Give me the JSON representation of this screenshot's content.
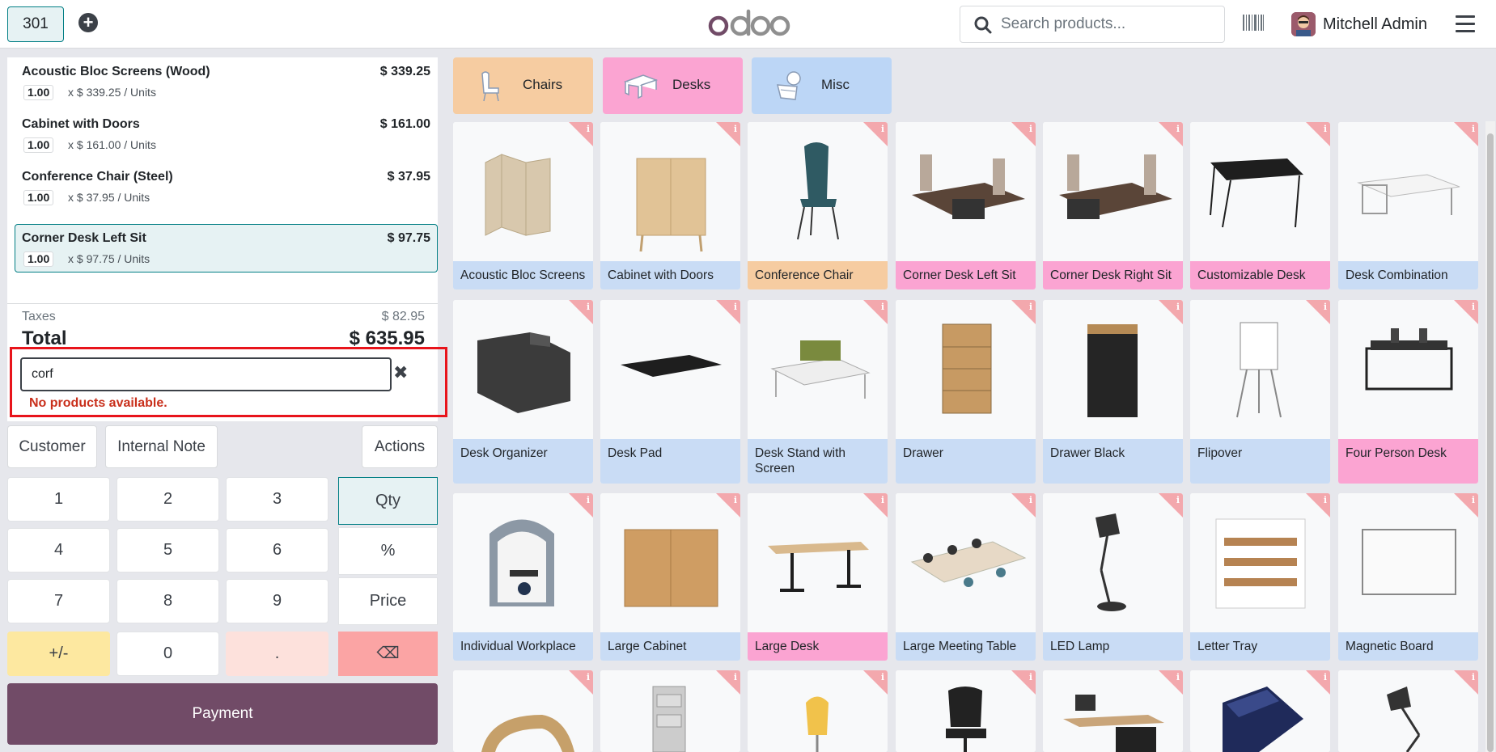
{
  "topbar": {
    "order_tab": "301",
    "logo": "odoo",
    "search_placeholder": "Search products...",
    "user_name": "Mitchell Admin"
  },
  "orderlines": [
    {
      "name": "Acoustic Bloc Screens (Wood)",
      "price": "$ 339.25",
      "qty": "1.00",
      "unit": "x $ 339.25 / Units"
    },
    {
      "name": "Cabinet with Doors",
      "price": "$ 161.00",
      "qty": "1.00",
      "unit": "x $ 161.00 / Units"
    },
    {
      "name": "Conference Chair (Steel)",
      "price": "$ 37.95",
      "qty": "1.00",
      "unit": "x $ 37.95 / Units"
    },
    {
      "name": "Corner Desk Left Sit",
      "price": "$ 97.75",
      "qty": "1.00",
      "unit": "x $ 97.75 / Units"
    }
  ],
  "summary": {
    "taxes_label": "Taxes",
    "taxes_value": "$ 82.95",
    "total_label": "Total",
    "total_value": "$ 635.95"
  },
  "product_search": {
    "value": "corf",
    "no_results": "No products available."
  },
  "controls": {
    "customer": "Customer",
    "internal_note": "Internal Note",
    "actions": "Actions"
  },
  "numpad": {
    "keys": [
      "1",
      "2",
      "3",
      "4",
      "5",
      "6",
      "7",
      "8",
      "9",
      "+/-",
      "0",
      "."
    ],
    "modes": [
      "Qty",
      "%",
      "Price",
      "⌫"
    ],
    "payment": "Payment"
  },
  "categories": [
    {
      "label": "Chairs",
      "color": "#f6cca1"
    },
    {
      "label": "Desks",
      "color": "#fba4d2"
    },
    {
      "label": "Misc",
      "color": "#bcd6f6"
    }
  ],
  "products": [
    "Acoustic Bloc Screens",
    "Cabinet with Doors",
    "Conference Chair",
    "Corner Desk Left Sit",
    "Corner Desk Right Sit",
    "Customizable Desk",
    "Desk Combination",
    "Desk Organizer",
    "Desk Pad",
    "Desk Stand with Screen",
    "Drawer",
    "Drawer Black",
    "Flipover",
    "Four Person Desk",
    "Individual Workplace",
    "Large Cabinet",
    "Large Desk",
    "Large Meeting Table",
    "LED Lamp",
    "Letter Tray",
    "Magnetic Board"
  ],
  "colors": {
    "accent": "#017e84",
    "payment": "#714b67",
    "error": "#c9301c",
    "highlight": "#e8141b"
  }
}
